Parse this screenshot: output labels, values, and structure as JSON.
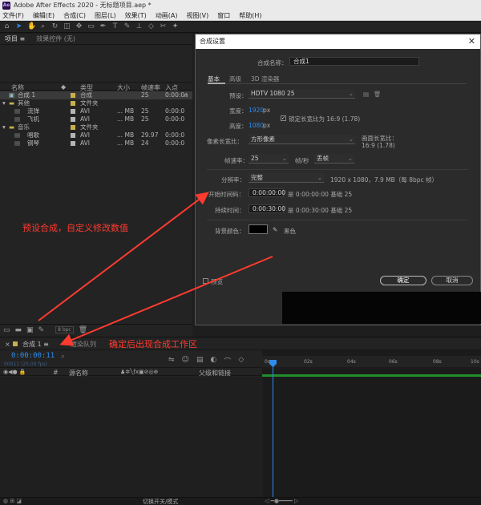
{
  "titlebar": {
    "logo": "Ae",
    "title": "Adobe After Effects 2020 - 无标题项目.aep *"
  },
  "menubar": [
    "文件(F)",
    "编辑(E)",
    "合成(C)",
    "图层(L)",
    "效果(T)",
    "动画(A)",
    "视图(V)",
    "窗口",
    "帮助(H)"
  ],
  "project": {
    "tabs": [
      "项目 ≡",
      "效果控件 (无)"
    ],
    "columns": [
      "名称",
      "类型",
      "大小",
      "帧速率",
      "入点"
    ],
    "rows": [
      {
        "name": "合成 1",
        "color": "#c8b04a",
        "type": "合成",
        "size": "",
        "fps": "25",
        "inpoint": "0:00:0",
        "selected": true
      },
      {
        "name": "其他",
        "color": "#c8b04a",
        "type": "文件夹",
        "size": "",
        "fps": "",
        "inpoint": ""
      },
      {
        "name": "流弹",
        "color": "#b5b5b5",
        "type": "AVI",
        "size": "... MB",
        "fps": "25",
        "inpoint": "0:00:0"
      },
      {
        "name": "飞机",
        "color": "#b5b5b5",
        "type": "AVI",
        "size": "... MB",
        "fps": "25",
        "inpoint": "0:00:0"
      },
      {
        "name": "音乐",
        "color": "#c8b04a",
        "type": "文件夹",
        "size": "",
        "fps": "",
        "inpoint": ""
      },
      {
        "name": "唱歌",
        "color": "#b5b5b5",
        "type": "AVI",
        "size": "... MB",
        "fps": "29.97",
        "inpoint": "0:00:0"
      },
      {
        "name": "钢琴",
        "color": "#b5b5b5",
        "type": "AVI",
        "size": "... MB",
        "fps": "24",
        "inpoint": "0:00:0"
      }
    ],
    "bpc": "8 bpc"
  },
  "dialog": {
    "title": "合成设置",
    "close": "✕",
    "name_label": "合成名称：",
    "name_value": "合成1",
    "tabs": [
      "基本",
      "高级",
      "3D 渲染器"
    ],
    "preset_label": "预设：",
    "preset_value": "HDTV 1080 25",
    "width_label": "宽度：",
    "width_value": "1920",
    "width_unit": "px",
    "height_label": "高度：",
    "height_value": "1080",
    "height_unit": "px",
    "lock_label": "锁定长宽比为 16:9 (1.78)",
    "par_label": "像素长宽比：",
    "par_value": "方形像素",
    "frame_aspect_label": "画面长宽比：",
    "frame_aspect_value": "16:9 (1.78)",
    "fps_label": "帧速率：",
    "fps_value": "25",
    "fps_unit": "帧/秒",
    "fps_drop": "丢帧",
    "res_label": "分辨率：",
    "res_value": "完整",
    "res_info": "1920 x 1080，7.9 MB（每 8bpc 帧）",
    "start_label": "开始时间码：",
    "start_value": "0:00:00:00",
    "start_info": "是 0:00:00:00  基础 25",
    "dur_label": "持续时间：",
    "dur_value": "0:00:30:00",
    "dur_info": "是 0:00:30:00  基础 25",
    "bg_label": "背景颜色：",
    "bg_value": "黑色",
    "preview_label": "预览",
    "ok": "确定",
    "cancel": "取消"
  },
  "timeline": {
    "tab": "合成 1  ≡",
    "tab2": "渲染队列",
    "timecode": "0:00:00:11",
    "timecode_sub": "00011 (25.00 fps)",
    "col_layer": "源名称",
    "col_parent": "父级和链接",
    "ruler": [
      "0s",
      "02s",
      "04s",
      "06s",
      "08s",
      "10s"
    ],
    "footer": "切换开关/模式"
  },
  "annotations": {
    "a1": "预设合成，自定义修改数值",
    "a2": "确定后出现合成工作区"
  },
  "colors": {
    "accent": "#2d8ceb",
    "annotation": "#ff3b30",
    "green": "#1f8f2a"
  }
}
